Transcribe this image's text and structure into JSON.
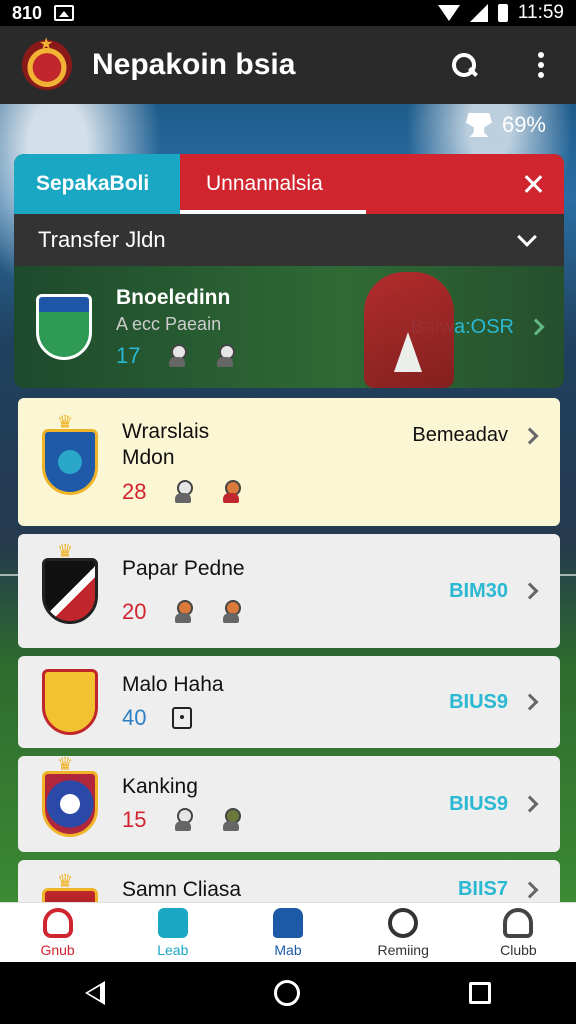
{
  "status_bar": {
    "left_text": "810",
    "time": "11:59"
  },
  "app": {
    "title": "Nepakoin bsia"
  },
  "stat": {
    "value": "69%"
  },
  "tabs": [
    {
      "label": "SepakaBoli"
    },
    {
      "label": "Unnannalsia"
    }
  ],
  "transfer": {
    "title": "Transfer Jldn"
  },
  "featured": {
    "name": "Bnoeledinn",
    "sub": "A ecc Paeain",
    "number": "17",
    "value": "Baiwa:OSR"
  },
  "rows": [
    {
      "name": "Wrarslais\nMdon",
      "number": "28",
      "value": "Bemeadav"
    },
    {
      "name": "Papar Pedne",
      "number": "20",
      "value": "BIM30"
    },
    {
      "name": "Malo Haha",
      "number": "40",
      "value": "BIUS9"
    },
    {
      "name": "Kanking",
      "number": "15",
      "value": "BIUS9"
    },
    {
      "name": "Samn Cliasa",
      "number": "",
      "value": "BIIS7"
    }
  ],
  "bottom_nav": [
    {
      "label": "Gnub"
    },
    {
      "label": "Leab"
    },
    {
      "label": "Mab"
    },
    {
      "label": "Remiing"
    },
    {
      "label": "Clubb"
    }
  ],
  "colors": {
    "accent_cyan": "#1aa7c3",
    "accent_red": "#d0252f",
    "app_bar": "#2a2a2a"
  }
}
